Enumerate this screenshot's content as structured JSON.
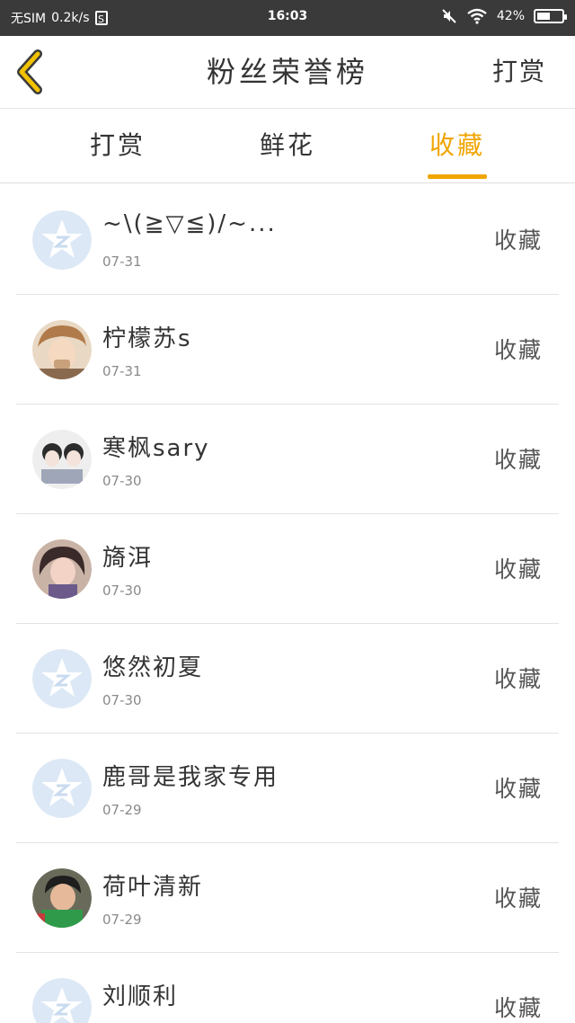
{
  "status_bar": {
    "carrier": "无SIM",
    "speed": "0.2k/s",
    "sim_badge": "S",
    "time": "16:03",
    "battery": "42%"
  },
  "header": {
    "title": "粉丝荣誉榜",
    "action": "打赏"
  },
  "tabs": [
    {
      "label": "打赏",
      "active": false
    },
    {
      "label": "鲜花",
      "active": false
    },
    {
      "label": "收藏",
      "active": true
    }
  ],
  "colors": {
    "accent": "#f0a500",
    "status_bar_bg": "#3a3a3a",
    "default_avatar": "#dce8f5"
  },
  "rows": [
    {
      "name": "~\\(≧▽≦)/~...",
      "date": "07-31",
      "action": "收藏",
      "avatar": "default-avatar-icon"
    },
    {
      "name": "柠檬苏s",
      "date": "07-31",
      "action": "收藏",
      "avatar": "user-photo"
    },
    {
      "name": "寒枫sary",
      "date": "07-30",
      "action": "收藏",
      "avatar": "user-photo"
    },
    {
      "name": "旖洱",
      "date": "07-30",
      "action": "收藏",
      "avatar": "user-photo"
    },
    {
      "name": "悠然初夏",
      "date": "07-30",
      "action": "收藏",
      "avatar": "default-avatar-icon"
    },
    {
      "name": "鹿哥是我家专用",
      "date": "07-29",
      "action": "收藏",
      "avatar": "default-avatar-icon"
    },
    {
      "name": "荷叶清新",
      "date": "07-29",
      "action": "收藏",
      "avatar": "user-photo"
    },
    {
      "name": "刘顺利",
      "date": "",
      "action": "收藏",
      "avatar": "default-avatar-icon"
    }
  ]
}
